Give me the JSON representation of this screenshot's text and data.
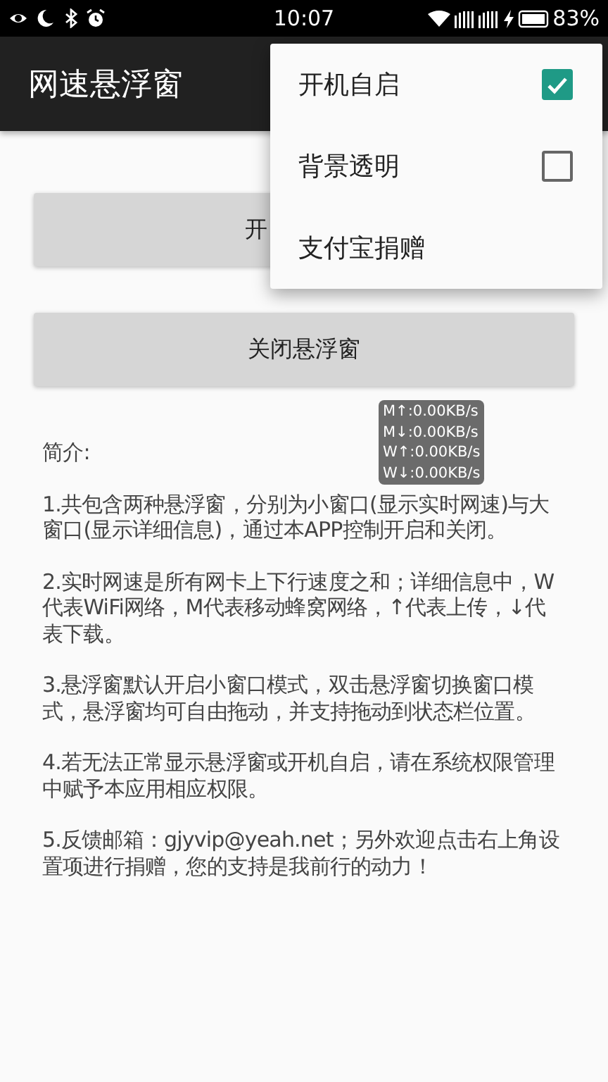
{
  "status_bar": {
    "time": "10:07",
    "battery": "83%"
  },
  "app_bar": {
    "title": "网速悬浮窗"
  },
  "buttons": [
    {
      "label": "开"
    },
    {
      "label": "关闭悬浮窗"
    }
  ],
  "menu": [
    {
      "label": "开机自启",
      "kind": "checkbox",
      "checked": true
    },
    {
      "label": "背景透明",
      "kind": "checkbox",
      "checked": false
    },
    {
      "label": "支付宝捐赠",
      "kind": "action"
    }
  ],
  "speed_widget": [
    "M↑:0.00KB/s",
    "M↓:0.00KB/s",
    "W↑:0.00KB/s",
    "W↓:0.00KB/s"
  ],
  "intro": {
    "heading": "简介:",
    "paragraphs": [
      "1.共包含两种悬浮窗，分别为小窗口(显示实时网速)与大窗口(显示详细信息)，通过本APP控制开启和关闭。",
      "2.实时网速是所有网卡上下行速度之和；详细信息中，W代表WiFi网络，M代表移动蜂窝网络，↑代表上传，↓代表下载。",
      "3.悬浮窗默认开启小窗口模式，双击悬浮窗切换窗口模式，悬浮窗均可自由拖动，并支持拖动到状态栏位置。",
      "4.若无法正常显示悬浮窗或开机自启，请在系统权限管理中赋予本应用相应权限。",
      "5.反馈邮箱：gjyvip@yeah.net；另外欢迎点击右上角设置项进行捐赠，您的支持是我前行的动力！"
    ]
  }
}
